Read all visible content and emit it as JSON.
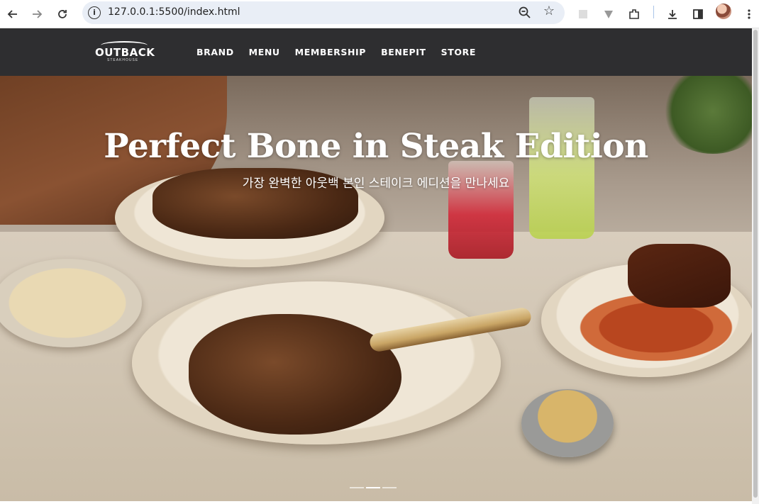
{
  "browser": {
    "url": "127.0.0.1:5500/index.html",
    "icons": [
      "back-icon",
      "forward-icon",
      "reload-icon",
      "site-info-icon",
      "zoom-icon",
      "bookmark-star-icon",
      "extension-icon",
      "downloads-icon",
      "sidebar-icon",
      "profile-avatar",
      "menu-kebab-icon"
    ]
  },
  "site": {
    "logo": {
      "word": "OUTBACK",
      "sub": "STEAKHOUSE"
    },
    "nav": [
      "BRAND",
      "MENU",
      "MEMBERSHIP",
      "BENEPIT",
      "STORE"
    ]
  },
  "hero": {
    "headline": "Perfect Bone in Steak Edition",
    "subline": "가장 완벽한 아웃백 본인 스테이크 에디션을 만나세요",
    "slides_total": 3,
    "active_slide": 2
  }
}
